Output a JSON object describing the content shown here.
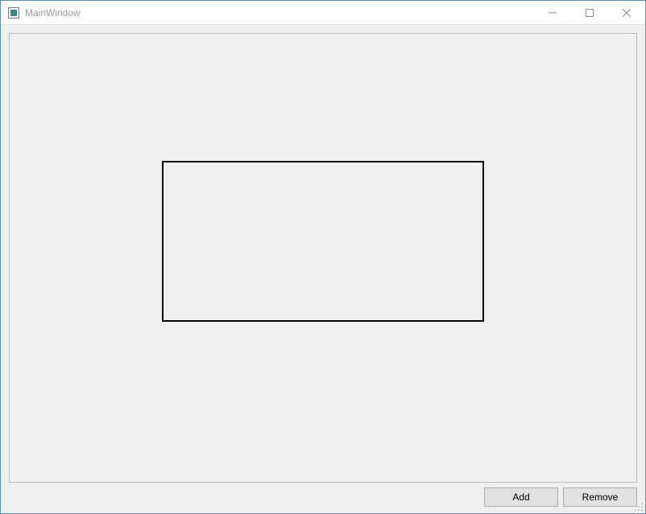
{
  "window": {
    "title": "MainWindow"
  },
  "buttons": {
    "add_label": "Add",
    "remove_label": "Remove"
  }
}
